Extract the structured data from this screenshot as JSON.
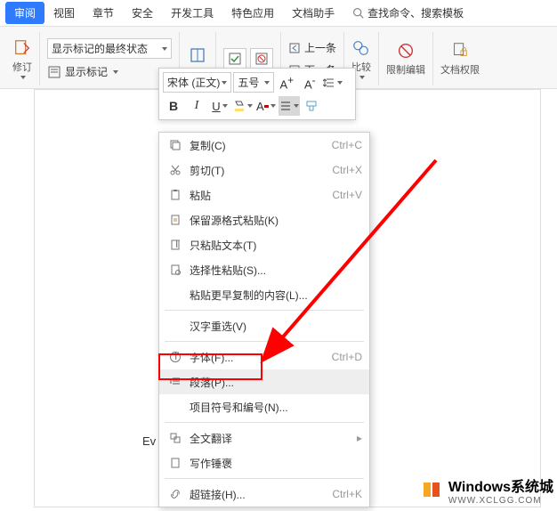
{
  "menubar": {
    "tabs": [
      "审阅",
      "视图",
      "章节",
      "安全",
      "开发工具",
      "特色应用",
      "文档助手"
    ],
    "search_placeholder": "查找命令、搜索模板"
  },
  "toolbar": {
    "revise": "修订",
    "status_combo": "显示标记的最终状态",
    "show_marks": "显示标记",
    "prev": "上一条",
    "next": "下一条",
    "compare": "比较",
    "restrict": "限制编辑",
    "docperm": "文档权限"
  },
  "floatbar": {
    "font_name": "宋体 (正文)",
    "font_size": "五号"
  },
  "ctx": {
    "copy": {
      "l": "复制(C)",
      "s": "Ctrl+C"
    },
    "cut": {
      "l": "剪切(T)",
      "s": "Ctrl+X"
    },
    "paste": {
      "l": "粘贴",
      "s": "Ctrl+V"
    },
    "paste_keep": {
      "l": "保留源格式粘贴(K)"
    },
    "paste_text": {
      "l": "只粘贴文本(T)"
    },
    "paste_sel": {
      "l": "选择性粘贴(S)..."
    },
    "paste_earlier": {
      "l": "粘贴更早复制的内容(L)..."
    },
    "hanzi": {
      "l": "汉字重选(V)"
    },
    "font": {
      "l": "字体(F)...",
      "s": "Ctrl+D"
    },
    "paragraph": {
      "l": "段落(P)..."
    },
    "bullets": {
      "l": "项目符号和编号(N)..."
    },
    "translate": {
      "l": "全文翻译"
    },
    "writing": {
      "l": "写作锤褒"
    },
    "link": {
      "l": "超链接(H)...",
      "s": "Ctrl+K"
    }
  },
  "watermark": {
    "big": "Windows系统城",
    "url": "WWW.XCLGG.COM"
  },
  "ev": "Ev"
}
